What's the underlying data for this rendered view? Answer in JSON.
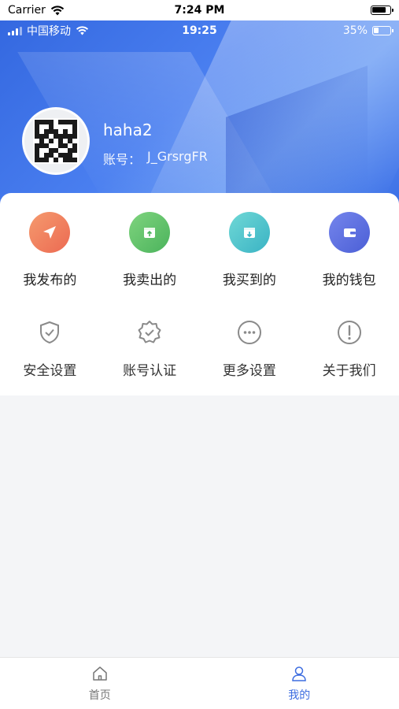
{
  "sim_status": {
    "carrier": "Carrier",
    "time": "7:24 PM"
  },
  "device_status": {
    "carrier": "中国移动",
    "time": "19:25",
    "battery": "35%"
  },
  "profile": {
    "username": "haha2",
    "account_label": "账号：",
    "account_id": "J_GrsrgFR"
  },
  "primary_menu": [
    {
      "label": "我发布的",
      "icon": "send-icon",
      "color": "#f07a5a"
    },
    {
      "label": "我卖出的",
      "icon": "box-upload-icon",
      "color": "#5fc36a"
    },
    {
      "label": "我买到的",
      "icon": "box-download-icon",
      "color": "#4cc3c8"
    },
    {
      "label": "我的钱包",
      "icon": "wallet-icon",
      "color": "#5b6ee0"
    }
  ],
  "secondary_menu": [
    {
      "label": "安全设置",
      "icon": "shield-check-icon"
    },
    {
      "label": "账号认证",
      "icon": "badge-check-icon"
    },
    {
      "label": "更多设置",
      "icon": "more-dots-icon"
    },
    {
      "label": "关于我们",
      "icon": "info-exclamation-icon"
    }
  ],
  "tabbar": {
    "tabs": [
      {
        "label": "首页",
        "icon": "home-icon",
        "active": false
      },
      {
        "label": "我的",
        "icon": "person-icon",
        "active": true
      }
    ],
    "active_color": "#3d6de0",
    "inactive_color": "#777777"
  }
}
